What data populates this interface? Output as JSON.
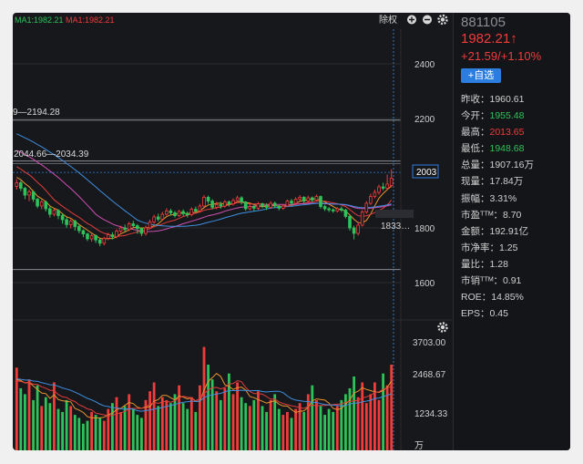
{
  "header": {
    "ma_labels": [
      {
        "text": "MA1:1982.21",
        "color": "#2ec25a"
      },
      {
        "text": "MA1:1982.21",
        "color": "#f23b3b"
      }
    ],
    "adjust_label": "除权"
  },
  "price_chart": {
    "y_ticks": [
      "2400",
      "2200",
      "1800",
      "1600"
    ],
    "annotation_high": "9—2194.28",
    "annotation_range": "2044.66—2034.39",
    "current_price_tag": "2003",
    "low_price_tag": "1833…"
  },
  "volume_chart": {
    "y_ticks": [
      "3703.00",
      "2468.67",
      "1234.33"
    ],
    "unit_label": "万"
  },
  "quote": {
    "code": "881105",
    "price": "1982.21↑",
    "change": "+21.59/+1.10%",
    "watch_button": "+自选",
    "stats": [
      {
        "label": "昨收：",
        "value": "1960.61",
        "tone": "neutral"
      },
      {
        "label": "今开：",
        "value": "1955.48",
        "tone": "down"
      },
      {
        "label": "最高：",
        "value": "2013.65",
        "tone": "high"
      },
      {
        "label": "最低：",
        "value": "1948.68",
        "tone": "down"
      },
      {
        "label": "总量：",
        "value": "1907.16万",
        "tone": "neutral"
      },
      {
        "label": "现量：",
        "value": "17.84万",
        "tone": "neutral"
      },
      {
        "label": "振幅：",
        "value": "3.31%",
        "tone": "neutral"
      },
      {
        "label": "市盈ᵀᵀᴹ：",
        "value": "8.70",
        "tone": "neutral"
      },
      {
        "label": "金额：",
        "value": "192.91亿",
        "tone": "neutral"
      },
      {
        "label": "市净率：",
        "value": "1.25",
        "tone": "neutral"
      },
      {
        "label": "量比：",
        "value": "1.28",
        "tone": "neutral"
      },
      {
        "label": "市销ᵀᵀᴹ：",
        "value": "0.91",
        "tone": "neutral"
      },
      {
        "label": "ROE：",
        "value": "14.85%",
        "tone": "neutral"
      },
      {
        "label": "EPS：",
        "value": "0.45",
        "tone": "neutral"
      }
    ]
  },
  "colors": {
    "up": "#f23b3b",
    "down": "#2ec25a",
    "ma_blue": "#3f8fe0",
    "ma_pink": "#d04fb4",
    "ma_orange": "#e8962e",
    "ma_red": "#e23c3c",
    "tag_blue": "#2b7ee0"
  },
  "chart_data": {
    "type": "candlestick",
    "price_axis": {
      "ticks": [
        2400,
        2200,
        1800,
        1600
      ]
    },
    "levels": [
      2194.28,
      2044.66,
      2034.39,
      2003
    ],
    "candles": [
      [
        1952,
        1965,
        1978,
        1940
      ],
      [
        1965,
        1945,
        1972,
        1935
      ],
      [
        1945,
        1920,
        1950,
        1905
      ],
      [
        1920,
        1932,
        1940,
        1898
      ],
      [
        1932,
        1905,
        1938,
        1895
      ],
      [
        1905,
        1880,
        1910,
        1872
      ],
      [
        1880,
        1895,
        1902,
        1868
      ],
      [
        1895,
        1870,
        1900,
        1860
      ],
      [
        1870,
        1850,
        1878,
        1838
      ],
      [
        1850,
        1864,
        1870,
        1842
      ],
      [
        1864,
        1845,
        1868,
        1832
      ],
      [
        1845,
        1830,
        1852,
        1815
      ],
      [
        1830,
        1812,
        1838,
        1800
      ],
      [
        1812,
        1825,
        1832,
        1798
      ],
      [
        1825,
        1805,
        1830,
        1790
      ],
      [
        1805,
        1790,
        1812,
        1780
      ],
      [
        1790,
        1778,
        1795,
        1766
      ],
      [
        1778,
        1760,
        1782,
        1752
      ],
      [
        1760,
        1772,
        1778,
        1750
      ],
      [
        1772,
        1756,
        1776,
        1745
      ],
      [
        1756,
        1744,
        1762,
        1733
      ],
      [
        1744,
        1762,
        1768,
        1736
      ],
      [
        1762,
        1775,
        1782,
        1755
      ],
      [
        1775,
        1768,
        1784,
        1758
      ],
      [
        1768,
        1788,
        1795,
        1762
      ],
      [
        1788,
        1800,
        1808,
        1782
      ],
      [
        1800,
        1794,
        1812,
        1786
      ],
      [
        1794,
        1815,
        1822,
        1788
      ],
      [
        1815,
        1808,
        1826,
        1800
      ],
      [
        1808,
        1798,
        1814,
        1778
      ],
      [
        1798,
        1780,
        1802,
        1770
      ],
      [
        1780,
        1800,
        1808,
        1772
      ],
      [
        1800,
        1822,
        1830,
        1796
      ],
      [
        1822,
        1840,
        1848,
        1815
      ],
      [
        1840,
        1832,
        1852,
        1824
      ],
      [
        1832,
        1850,
        1858,
        1826
      ],
      [
        1850,
        1862,
        1872,
        1845
      ],
      [
        1862,
        1855,
        1870,
        1846
      ],
      [
        1855,
        1845,
        1862,
        1838
      ],
      [
        1845,
        1860,
        1866,
        1840
      ],
      [
        1860,
        1852,
        1868,
        1844
      ],
      [
        1852,
        1848,
        1860,
        1838
      ],
      [
        1848,
        1868,
        1875,
        1842
      ],
      [
        1868,
        1862,
        1878,
        1855
      ],
      [
        1862,
        1880,
        1888,
        1856
      ],
      [
        1880,
        1912,
        1920,
        1875
      ],
      [
        1912,
        1898,
        1918,
        1888
      ],
      [
        1898,
        1875,
        1905,
        1868
      ],
      [
        1875,
        1885,
        1895,
        1868
      ],
      [
        1885,
        1880,
        1896,
        1870
      ],
      [
        1880,
        1895,
        1902,
        1874
      ],
      [
        1895,
        1888,
        1900,
        1878
      ],
      [
        1888,
        1900,
        1908,
        1882
      ],
      [
        1900,
        1910,
        1918,
        1892
      ],
      [
        1910,
        1895,
        1916,
        1886
      ],
      [
        1895,
        1870,
        1898,
        1862
      ],
      [
        1870,
        1878,
        1888,
        1864
      ],
      [
        1878,
        1872,
        1885,
        1862
      ],
      [
        1872,
        1888,
        1895,
        1866
      ],
      [
        1888,
        1880,
        1892,
        1872
      ],
      [
        1880,
        1875,
        1890,
        1866
      ],
      [
        1875,
        1890,
        1898,
        1870
      ],
      [
        1890,
        1880,
        1896,
        1872
      ],
      [
        1880,
        1872,
        1884,
        1864
      ],
      [
        1872,
        1880,
        1886,
        1866
      ],
      [
        1880,
        1898,
        1904,
        1876
      ],
      [
        1898,
        1890,
        1906,
        1880
      ],
      [
        1890,
        1905,
        1912,
        1884
      ],
      [
        1905,
        1912,
        1920,
        1898
      ],
      [
        1912,
        1898,
        1916,
        1888
      ],
      [
        1898,
        1910,
        1918,
        1892
      ],
      [
        1910,
        1902,
        1915,
        1894
      ],
      [
        1902,
        1915,
        1922,
        1896
      ],
      [
        1915,
        1878,
        1918,
        1870
      ],
      [
        1878,
        1870,
        1884,
        1862
      ],
      [
        1870,
        1866,
        1876,
        1858
      ],
      [
        1866,
        1862,
        1872,
        1855
      ],
      [
        1862,
        1870,
        1876,
        1856
      ],
      [
        1870,
        1865,
        1878,
        1858
      ],
      [
        1865,
        1842,
        1870,
        1835
      ],
      [
        1842,
        1800,
        1848,
        1790
      ],
      [
        1800,
        1780,
        1808,
        1758
      ],
      [
        1780,
        1810,
        1818,
        1772
      ],
      [
        1810,
        1858,
        1865,
        1805
      ],
      [
        1858,
        1890,
        1898,
        1852
      ],
      [
        1890,
        1915,
        1925,
        1884
      ],
      [
        1915,
        1930,
        1940,
        1908
      ],
      [
        1930,
        1950,
        1958,
        1922
      ],
      [
        1950,
        1945,
        1965,
        1938
      ],
      [
        1945,
        1960,
        1995,
        1940
      ],
      [
        1955,
        1982,
        2014,
        1948
      ]
    ],
    "volume_axis": {
      "ticks": [
        3703.0,
        2468.67,
        1234.33
      ],
      "unit": "万"
    },
    "volumes": [
      2800,
      2100,
      1900,
      2400,
      1700,
      2200,
      1500,
      1800,
      1600,
      2300,
      1400,
      1300,
      1700,
      1500,
      1200,
      1100,
      900,
      1000,
      1300,
      1200,
      1100,
      1000,
      1400,
      1600,
      1800,
      1300,
      1500,
      1900,
      1400,
      1200,
      1100,
      1700,
      2000,
      2300,
      1500,
      1800,
      1700,
      1600,
      1900,
      2200,
      1600,
      1400,
      1800,
      1300,
      2200,
      3500,
      2900,
      2400,
      2000,
      1700,
      2100,
      2600,
      1900,
      2300,
      1800,
      1600,
      1500,
      1700,
      2000,
      1500,
      1300,
      1700,
      1900,
      1400,
      1200,
      1300,
      1100,
      1400,
      1600,
      1300,
      1900,
      2200,
      1700,
      1500,
      1200,
      1400,
      1300,
      1500,
      1700,
      1900,
      2100,
      2500,
      1800,
      2300,
      1600,
      1900,
      2300,
      1700,
      2600,
      2200,
      2900
    ]
  }
}
